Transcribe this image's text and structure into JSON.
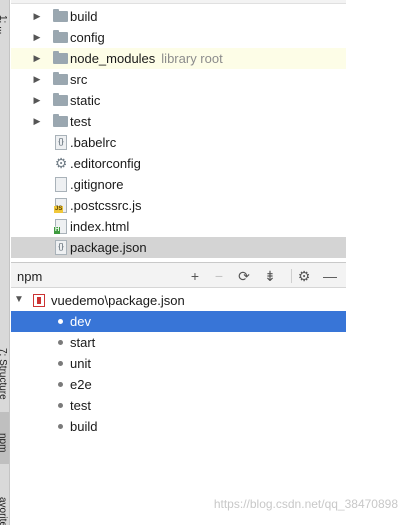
{
  "tool_strip": {
    "tabs": [
      {
        "label": "1: ..."
      },
      {
        "label": "7: Structure"
      },
      {
        "label": "npm"
      },
      {
        "label": "avorites"
      }
    ]
  },
  "project_tree": {
    "items": [
      {
        "label": "build",
        "type": "folder"
      },
      {
        "label": "config",
        "type": "folder"
      },
      {
        "label": "node_modules",
        "hint": "library root",
        "type": "folder"
      },
      {
        "label": "src",
        "type": "folder"
      },
      {
        "label": "static",
        "type": "folder"
      },
      {
        "label": "test",
        "type": "folder"
      },
      {
        "label": ".babelrc",
        "type": "json-file"
      },
      {
        "label": ".editorconfig",
        "type": "config-file"
      },
      {
        "label": ".gitignore",
        "type": "text-file"
      },
      {
        "label": ".postcssrc.js",
        "type": "js-file"
      },
      {
        "label": "index.html",
        "type": "html-file"
      },
      {
        "label": "package.json",
        "type": "json-file"
      }
    ]
  },
  "npm_panel": {
    "title": "npm",
    "toolbar": {
      "add_icon": "+",
      "remove_icon": "−",
      "refresh_icon": "⟳",
      "collapse_icon": "⇟",
      "settings_icon": "⚙",
      "hide_icon": "—"
    },
    "package_label": "vuedemo\\package.json",
    "scripts": [
      "dev",
      "start",
      "unit",
      "e2e",
      "test",
      "build"
    ],
    "selected_script": "dev"
  },
  "watermark": "https://blog.csdn.net/qq_38470898",
  "colors": {
    "selection": "#3875d7",
    "highlight_row": "#fdfde7",
    "folder": "#9aa7b0"
  }
}
